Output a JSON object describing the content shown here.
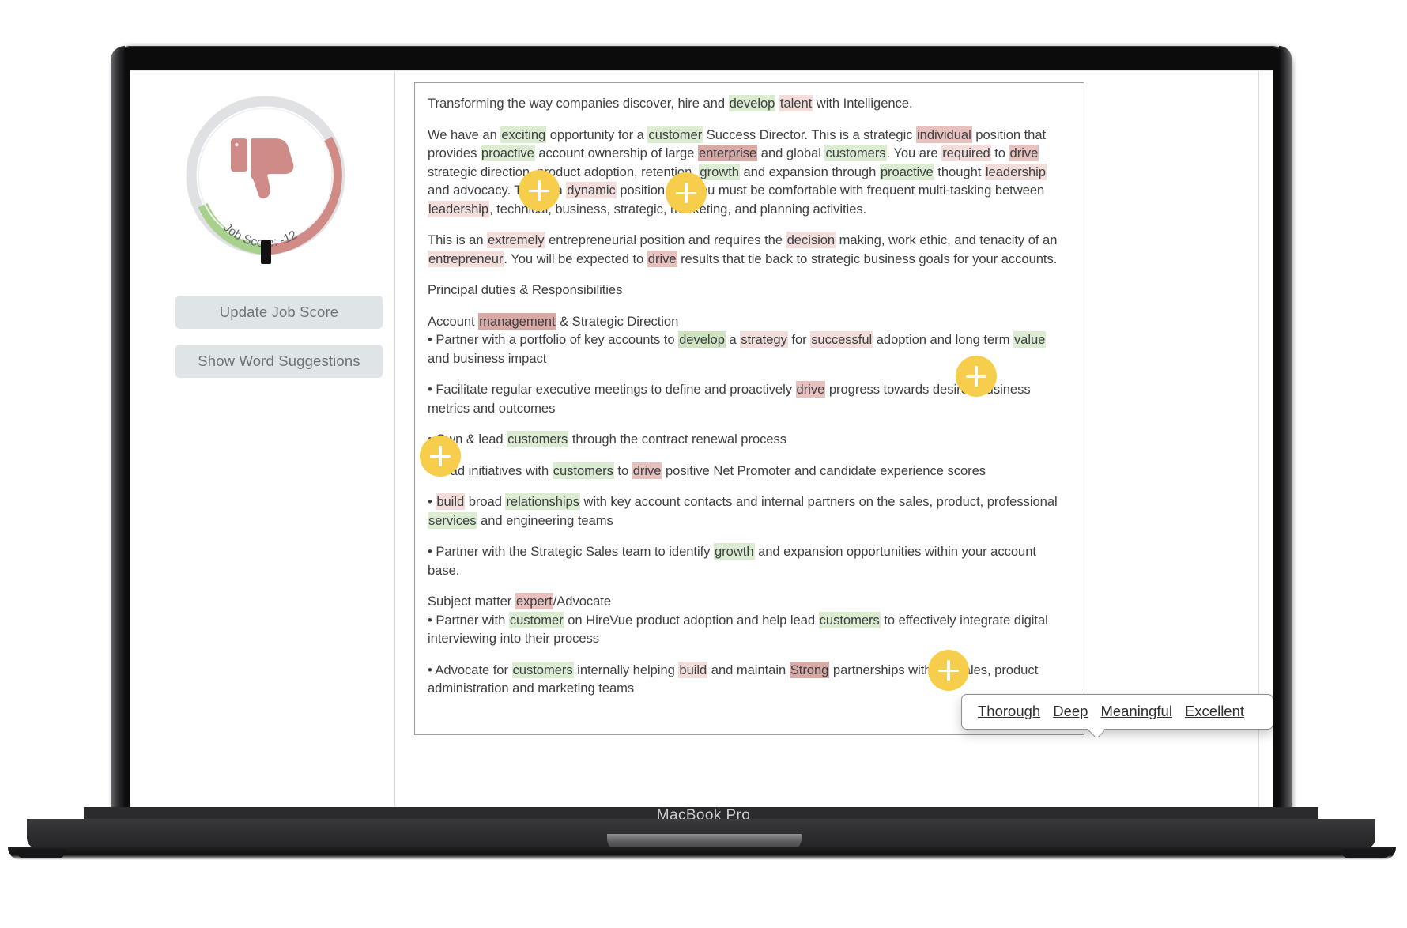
{
  "device": {
    "model_label": "MacBook Pro"
  },
  "sidebar": {
    "gauge": {
      "caption": "Job Score: -12",
      "score": -12,
      "icon": "thumbs-down-icon",
      "track_color": "#dfe1e4",
      "green_color": "#a8d18d",
      "red_color": "#d08b87",
      "needle_color": "#111111"
    },
    "buttons": [
      {
        "label": "Update Job Score",
        "name": "update-job-score-button"
      },
      {
        "label": "Show Word Suggestions",
        "name": "show-word-suggestions-button"
      }
    ]
  },
  "suggestions_popup": {
    "words": [
      "Thorough",
      "Deep",
      "Meaningful",
      "Excellent"
    ]
  },
  "hotspots": [
    {
      "id": 1,
      "icon": "plus-icon"
    },
    {
      "id": 2,
      "icon": "plus-icon"
    },
    {
      "id": 3,
      "icon": "plus-icon"
    },
    {
      "id": 4,
      "icon": "plus-icon"
    },
    {
      "id": 5,
      "icon": "plus-icon"
    }
  ],
  "document": {
    "paragraphs": [
      {
        "id": "p1",
        "runs": [
          {
            "t": "Transforming the way companies discover, hire and "
          },
          {
            "t": "develop",
            "h": "g"
          },
          {
            "t": " "
          },
          {
            "t": "talent",
            "h": "r"
          },
          {
            "t": " with Intelligence."
          }
        ]
      },
      {
        "id": "p2",
        "runs": [
          {
            "t": "We have an "
          },
          {
            "t": "exciting",
            "h": "g"
          },
          {
            "t": " opportunity for a "
          },
          {
            "t": "customer",
            "h": "g"
          },
          {
            "t": " Success Director. This is a strategic "
          },
          {
            "t": "individual",
            "h": "rm"
          },
          {
            "t": " position that provides "
          },
          {
            "t": "proactive",
            "h": "g"
          },
          {
            "t": " account ownership of large "
          },
          {
            "t": "enterprise",
            "h": "rd"
          },
          {
            "t": " and global "
          },
          {
            "t": "customers",
            "h": "g"
          },
          {
            "t": ". You are "
          },
          {
            "t": "required",
            "h": "r"
          },
          {
            "t": " to "
          },
          {
            "t": "drive",
            "h": "rm"
          },
          {
            "t": " strategic direction, product adoption, retention, "
          },
          {
            "t": "growth",
            "h": "g"
          },
          {
            "t": " and expansion through "
          },
          {
            "t": "proactive",
            "h": "g"
          },
          {
            "t": " thought "
          },
          {
            "t": "leadership",
            "h": "r"
          },
          {
            "t": " and advocacy. This is a "
          },
          {
            "t": "dynamic",
            "h": "r"
          },
          {
            "t": " position and you must be comfortable with frequent multi-tasking between "
          },
          {
            "t": "leadership",
            "h": "r"
          },
          {
            "t": ", technical, business, strategic, marketing, and planning activities."
          }
        ]
      },
      {
        "id": "p3",
        "runs": [
          {
            "t": "This is an "
          },
          {
            "t": "extremely",
            "h": "r"
          },
          {
            "t": " entrepreneurial position and requires the "
          },
          {
            "t": "decision",
            "h": "r"
          },
          {
            "t": " making, work ethic, and tenacity of an "
          },
          {
            "t": "entrepreneur",
            "h": "r"
          },
          {
            "t": ". You will be expected to "
          },
          {
            "t": "drive",
            "h": "rm"
          },
          {
            "t": " results that tie back to strategic business goals for your accounts."
          }
        ]
      },
      {
        "id": "p4",
        "runs": [
          {
            "t": "Principal duties & Responsibilities"
          }
        ]
      },
      {
        "id": "p5",
        "runs": [
          {
            "t": "Account "
          },
          {
            "t": "management",
            "h": "rd"
          },
          {
            "t": " & Strategic Direction"
          },
          {
            "br": true
          },
          {
            "t": "• Partner with a portfolio of key accounts to "
          },
          {
            "t": "develop",
            "h": "gd"
          },
          {
            "t": " a "
          },
          {
            "t": "strategy",
            "h": "r"
          },
          {
            "t": " for "
          },
          {
            "t": "successful",
            "h": "r"
          },
          {
            "t": " adoption and long term "
          },
          {
            "t": "value",
            "h": "g"
          },
          {
            "t": " and business impact"
          }
        ]
      },
      {
        "id": "p6",
        "runs": [
          {
            "t": "• Facilitate regular executive meetings to define and proactively "
          },
          {
            "t": "drive",
            "h": "rm"
          },
          {
            "t": " progress towards desired business metrics and outcomes"
          }
        ]
      },
      {
        "id": "p7",
        "runs": [
          {
            "t": "• Own & lead "
          },
          {
            "t": "customers",
            "h": "g"
          },
          {
            "t": " through the contract renewal process"
          }
        ]
      },
      {
        "id": "p8",
        "runs": [
          {
            "t": "• Lead initiatives with "
          },
          {
            "t": "customers",
            "h": "g"
          },
          {
            "t": " to "
          },
          {
            "t": "drive",
            "h": "rm"
          },
          {
            "t": " positive Net Promoter and candidate experience scores"
          }
        ]
      },
      {
        "id": "p9",
        "runs": [
          {
            "t": "• "
          },
          {
            "t": "build",
            "h": "r"
          },
          {
            "t": " broad "
          },
          {
            "t": "relationships",
            "h": "g"
          },
          {
            "t": " with key account contacts and internal partners on the sales, product, professional "
          },
          {
            "t": "services",
            "h": "g"
          },
          {
            "t": " and engineering teams"
          }
        ]
      },
      {
        "id": "p10",
        "runs": [
          {
            "t": "• Partner with the Strategic Sales team to identify "
          },
          {
            "t": "growth",
            "h": "g"
          },
          {
            "t": " and expansion opportunities within your account base."
          }
        ]
      },
      {
        "id": "p11",
        "runs": [
          {
            "t": "Subject matter "
          },
          {
            "t": "expert",
            "h": "rm"
          },
          {
            "t": "/Advocate"
          },
          {
            "br": true
          },
          {
            "t": "• Partner with "
          },
          {
            "t": "customer",
            "h": "g"
          },
          {
            "t": " on HireVue product adoption and help lead "
          },
          {
            "t": "customers",
            "h": "g"
          },
          {
            "t": " to effectively integrate digital interviewing into their process"
          }
        ]
      },
      {
        "id": "p12",
        "runs": [
          {
            "t": "• Advocate for "
          },
          {
            "t": "customers",
            "h": "g"
          },
          {
            "t": " internally helping "
          },
          {
            "t": "build",
            "h": "r"
          },
          {
            "t": " and maintain "
          },
          {
            "t": "Strong",
            "h": "rd"
          },
          {
            "t": " partnerships with the sales, product administration and marketing teams"
          }
        ]
      }
    ]
  }
}
